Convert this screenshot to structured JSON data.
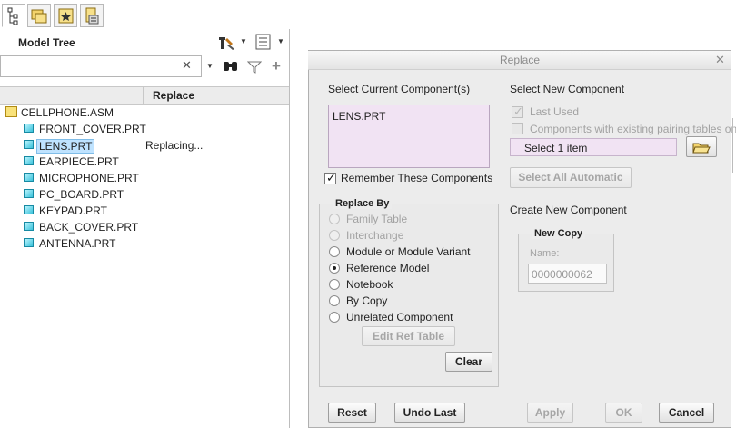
{
  "model_tree": {
    "title": "Model Tree",
    "column_header": "Replace",
    "search_clear": "✕",
    "items": [
      {
        "label": "CELLPHONE.ASM",
        "type": "assembly",
        "status": ""
      },
      {
        "label": "FRONT_COVER.PRT",
        "type": "part",
        "status": ""
      },
      {
        "label": "LENS.PRT",
        "type": "part",
        "status": "Replacing...",
        "selected": true
      },
      {
        "label": "EARPIECE.PRT",
        "type": "part",
        "status": ""
      },
      {
        "label": "MICROPHONE.PRT",
        "type": "part",
        "status": ""
      },
      {
        "label": "PC_BOARD.PRT",
        "type": "part",
        "status": ""
      },
      {
        "label": "KEYPAD.PRT",
        "type": "part",
        "status": ""
      },
      {
        "label": "BACK_COVER.PRT",
        "type": "part",
        "status": ""
      },
      {
        "label": "ANTENNA.PRT",
        "type": "part",
        "status": ""
      }
    ]
  },
  "dialog": {
    "title": "Replace",
    "close": "✕",
    "select_current_label": "Select Current Component(s)",
    "current_components": [
      "LENS.PRT"
    ],
    "remember_label": "Remember These Components",
    "remember_checked": true,
    "replace_by": {
      "title": "Replace By",
      "options": [
        {
          "label": "Family Table",
          "enabled": false,
          "selected": false
        },
        {
          "label": "Interchange",
          "enabled": false,
          "selected": false
        },
        {
          "label": "Module or Module Variant",
          "enabled": true,
          "selected": false
        },
        {
          "label": "Reference Model",
          "enabled": true,
          "selected": true
        },
        {
          "label": "Notebook",
          "enabled": true,
          "selected": false
        },
        {
          "label": "By Copy",
          "enabled": true,
          "selected": false
        },
        {
          "label": "Unrelated Component",
          "enabled": true,
          "selected": false
        }
      ],
      "edit_ref_table": "Edit Ref Table",
      "clear": "Clear"
    },
    "select_new_label": "Select New Component",
    "last_used_label": "Last Used",
    "pairing_label": "Components with existing pairing tables only",
    "select_placeholder": "Select 1 item",
    "select_all_automatic": "Select All Automatic",
    "create_new_label": "Create New Component",
    "new_copy": {
      "title": "New Copy",
      "name_label": "Name:",
      "name_value": "0000000062"
    },
    "buttons": {
      "reset": "Reset",
      "undo_last": "Undo Last",
      "apply": "Apply",
      "ok": "OK",
      "cancel": "Cancel"
    }
  },
  "colors": {
    "selection": "#bfe3ff",
    "listbox": "#f1e3f3",
    "part_icon": "#39c1da"
  }
}
